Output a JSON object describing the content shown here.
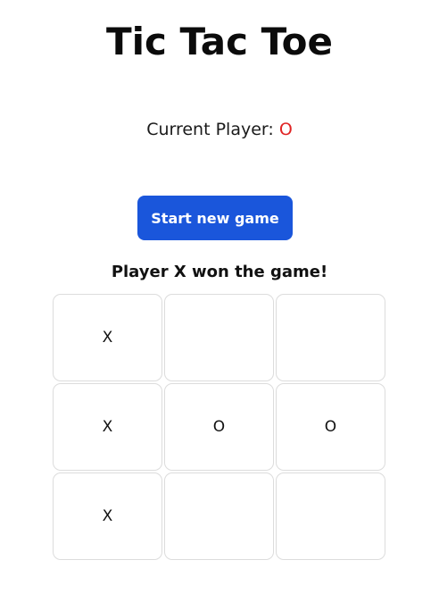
{
  "title": "Tic Tac Toe",
  "current_player": {
    "label": "Current Player:",
    "value": "O",
    "value_color": "#e02424"
  },
  "start_button": {
    "label": "Start new game",
    "color": "#1a56db"
  },
  "status": "Player X won the game!",
  "board": [
    [
      "X",
      "",
      ""
    ],
    [
      "X",
      "O",
      "O"
    ],
    [
      "X",
      "",
      ""
    ]
  ]
}
